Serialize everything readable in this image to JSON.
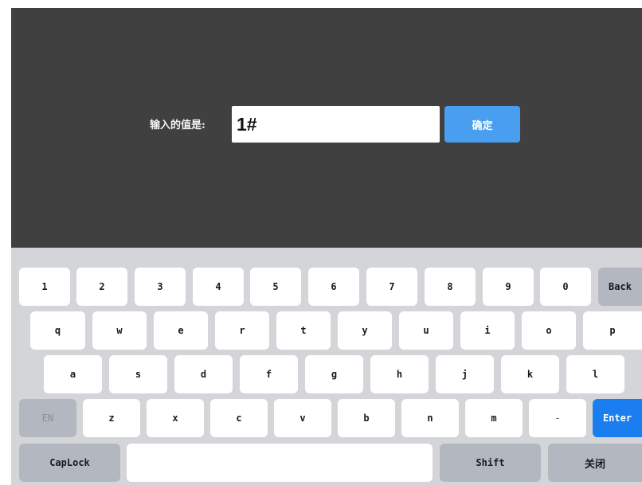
{
  "input": {
    "label": "输入的值是:",
    "value": "1#",
    "confirm_label": "确定"
  },
  "keyboard": {
    "row1": [
      "1",
      "2",
      "3",
      "4",
      "5",
      "6",
      "7",
      "8",
      "9",
      "0",
      "Back"
    ],
    "row2": [
      "q",
      "w",
      "e",
      "r",
      "t",
      "y",
      "u",
      "i",
      "o",
      "p"
    ],
    "row3": [
      "a",
      "s",
      "d",
      "f",
      "g",
      "h",
      "j",
      "k",
      "l"
    ],
    "row4": [
      "EN",
      "z",
      "x",
      "c",
      "v",
      "b",
      "n",
      "m",
      "-",
      "Enter"
    ],
    "row5": [
      "CapLock",
      "",
      "Shift",
      "关闭"
    ]
  }
}
